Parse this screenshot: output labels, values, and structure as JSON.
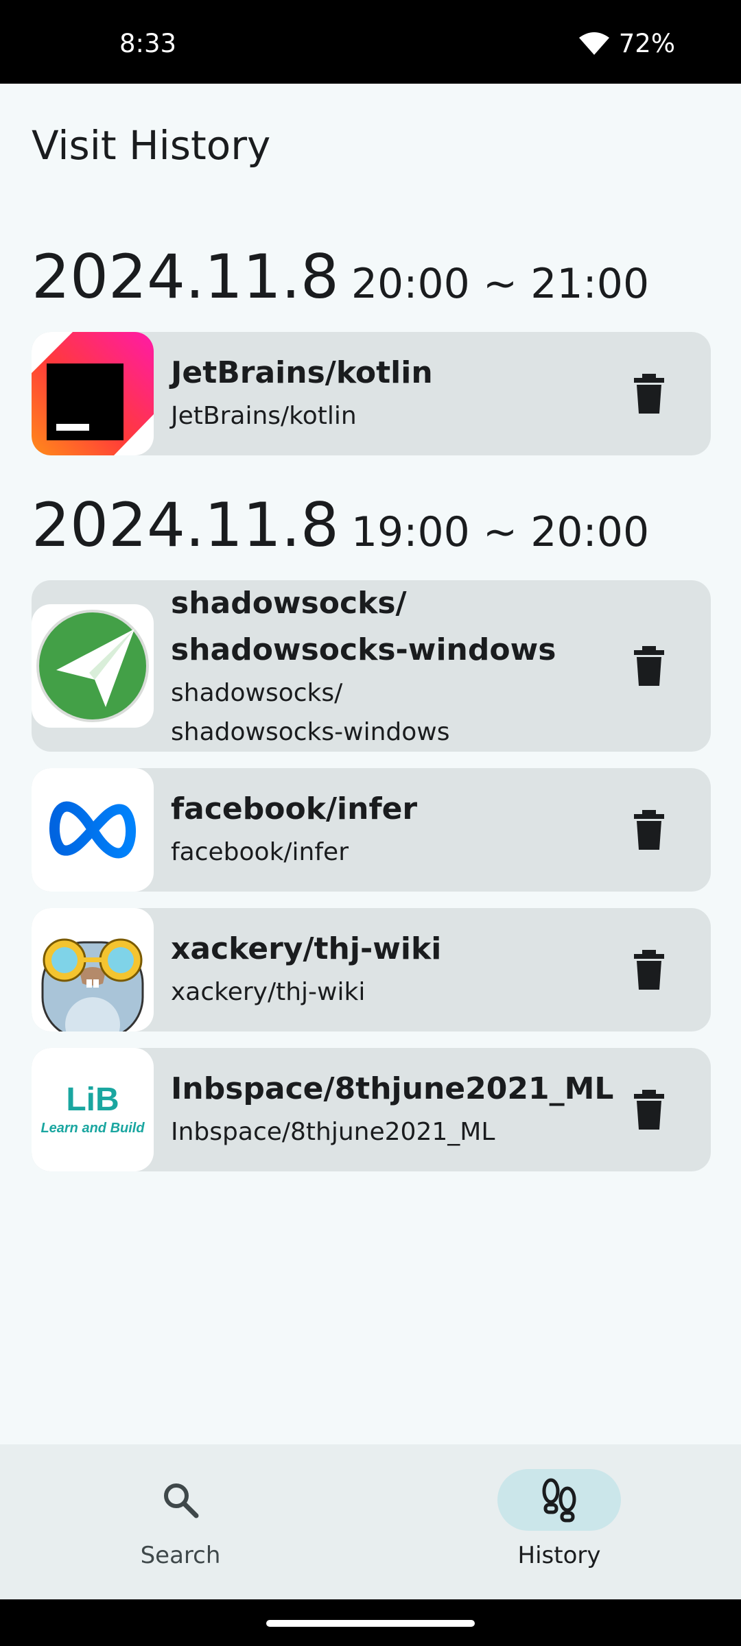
{
  "status": {
    "time": "8:33",
    "battery": "72%"
  },
  "page_title": "Visit History",
  "groups": [
    {
      "date": "2024.11.8",
      "range": "20:00 ~ 21:00"
    },
    {
      "date": "2024.11.8",
      "range": "19:00 ~ 20:00"
    }
  ],
  "items": [
    {
      "name": "JetBrains/kotlin",
      "sub": "JetBrains/kotlin",
      "icon": "jetbrains-logo-icon"
    },
    {
      "name_1": "shadowsocks/",
      "name_2": "shadowsocks-windows",
      "sub_1": "shadowsocks/",
      "sub_2": "shadowsocks-windows",
      "icon": "paper-plane-logo-icon"
    },
    {
      "name": "facebook/infer",
      "sub": "facebook/infer",
      "icon": "meta-logo-icon"
    },
    {
      "name": "xackery/thj-wiki",
      "sub": "xackery/thj-wiki",
      "icon": "gopher-avatar-icon"
    },
    {
      "name": "Inbspace/8thjune2021_ML",
      "sub": "Inbspace/8thjune2021_ML",
      "icon": "lib-logo-icon",
      "logo_top": "LiB",
      "logo_bottom": "Learn and Build"
    }
  ],
  "nav": {
    "search_label": "Search",
    "history_label": "History",
    "active": "History"
  },
  "colors": {
    "background": "#f4f9fa",
    "card": "#dde3e4",
    "active_pill": "#cbe6ea",
    "lib_teal": "#1aa6a0"
  }
}
